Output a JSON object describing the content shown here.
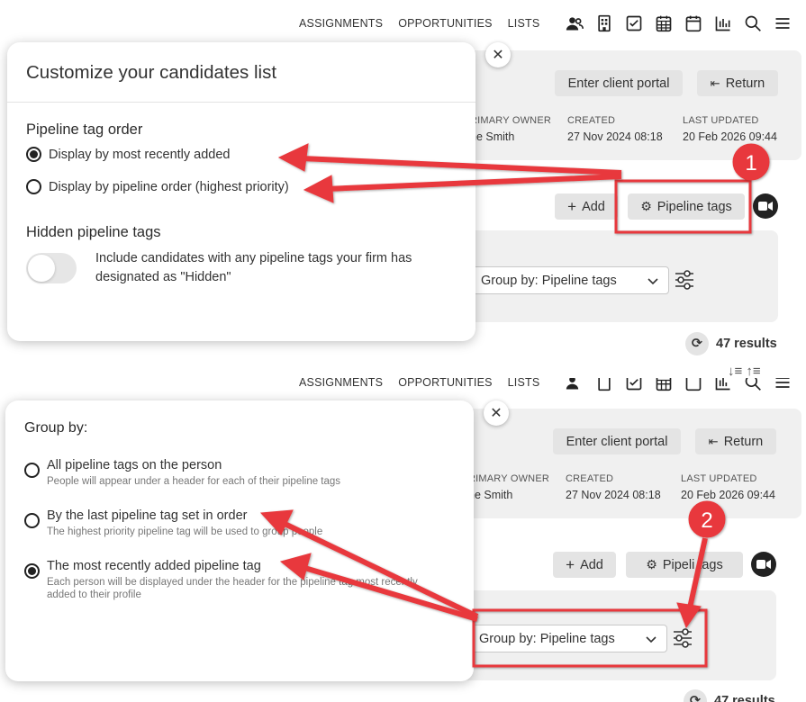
{
  "nav": {
    "links": [
      "ASSIGNMENTS",
      "OPPORTUNITIES",
      "LISTS"
    ],
    "icons": [
      "people-icon",
      "building-icon",
      "checkbox-icon",
      "calendar-grid-icon",
      "calendar-icon",
      "chart-icon",
      "search-icon",
      "menu-icon"
    ]
  },
  "background": {
    "enter_client_portal": "Enter client portal",
    "return": "Return",
    "primary_owner_label": "RIMARY OWNER",
    "primary_owner_value": "ne Smith",
    "created_label": "CREATED",
    "created_value": "27 Nov 2024 08:18",
    "last_updated_label": "LAST UPDATED",
    "last_updated_value": "20 Feb 2026 09:44",
    "add": "Add",
    "pipeline_tags_button": "Pipeline tags",
    "pipeline_tags_button_partial_a": "Pipeli",
    "pipeline_tags_button_partial_b": "tags",
    "group_by_select": "Group by: Pipeline tags",
    "results": "47 results"
  },
  "modal1": {
    "title": "Customize your candidates list",
    "order_section": "Pipeline tag order",
    "order_options": [
      {
        "label": "Display by most recently added",
        "checked": true
      },
      {
        "label": "Display by pipeline order (highest priority)",
        "checked": false
      }
    ],
    "hidden_section": "Hidden pipeline tags",
    "hidden_toggle_text_line1": "Include candidates with any pipeline tags your firm has",
    "hidden_toggle_text_line2": "designated as \"Hidden\"",
    "hidden_toggle_on": false
  },
  "modal2": {
    "title": "Group by:",
    "options": [
      {
        "title": "All pipeline tags on the person",
        "desc": "People will appear under a header for each of their pipeline tags",
        "checked": false
      },
      {
        "title": "By the last pipeline tag set in order",
        "desc": "The highest priority pipeline tag will be used to group people",
        "checked": false
      },
      {
        "title": "The most recently added pipeline tag",
        "desc": "Each person will be displayed under the header for the pipeline tag most recently added to their profile",
        "checked": true
      }
    ]
  },
  "annotations": {
    "callout_1": "1",
    "callout_2": "2",
    "arrow_color": "#e8393c"
  }
}
